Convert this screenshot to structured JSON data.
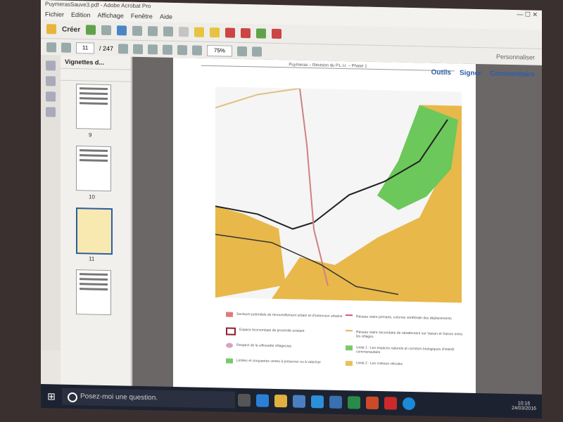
{
  "window": {
    "title": "PuymerasSauve3.pdf - Adobe Acrobat Pro"
  },
  "menu": [
    "Fichier",
    "Edition",
    "Affichage",
    "Fenêtre",
    "Aide"
  ],
  "toolbar": {
    "create_label": "Créer",
    "page_current": "11",
    "page_total": "/ 247",
    "zoom": "75%",
    "customize": "Personnaliser"
  },
  "right_tabs": [
    "Outils",
    "Signer",
    "Commentaire"
  ],
  "sidebar": {
    "panel_title": "Vignettes d...",
    "thumbs": [
      "9",
      "10",
      "11"
    ]
  },
  "document": {
    "header": "Puymeras – Révision du P.L.U. – Phase 1"
  },
  "legend": [
    {
      "text": "Secteurs potentiels de renouvellement urbain et d'extension urbaine",
      "color": "#e07a7a"
    },
    {
      "text": "Réseau viaire primaire, colonne vertébrale des déplacements",
      "color": "#d0566a"
    },
    {
      "text": "Espace économique de proximité existant",
      "color": "#ffffff"
    },
    {
      "text": "Réseau viaire secondaire de rabattement sur Vaison et Saison entre les villages",
      "color": "#e0b55a"
    },
    {
      "text": "Respect de la silhouette villageoise",
      "color": "#d9a0c0"
    },
    {
      "text": "Unité 1 : Les espaces naturels et corridors biologiques d'intérêt communautaire",
      "color": "#7bc96a"
    },
    {
      "text": "Limites et cinquantes vertes à préserver ou à valoriser",
      "color": "#7bc96a"
    },
    {
      "text": "Unité 2 : Les coteaux viticoles",
      "color": "#e8c25a"
    }
  ],
  "taskbar": {
    "search_placeholder": "Posez-moi une question.",
    "time": "10:16",
    "date": "24/03/2016"
  },
  "colors": {
    "accent": "#2a5da8",
    "taskbar": "#1c2230"
  }
}
